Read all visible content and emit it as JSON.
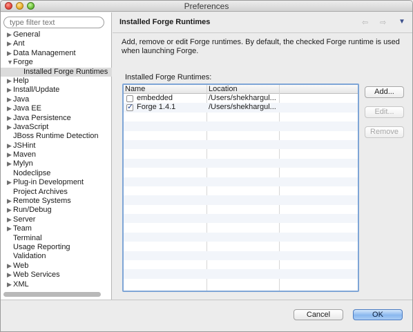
{
  "window": {
    "title": "Preferences"
  },
  "filter": {
    "placeholder": "type filter text"
  },
  "tree": [
    {
      "label": "General",
      "arrow": true,
      "expanded": false,
      "child": false
    },
    {
      "label": "Ant",
      "arrow": true,
      "expanded": false,
      "child": false
    },
    {
      "label": "Data Management",
      "arrow": true,
      "expanded": false,
      "child": false
    },
    {
      "label": "Forge",
      "arrow": true,
      "expanded": true,
      "child": false
    },
    {
      "label": "Installed Forge Runtimes",
      "arrow": false,
      "child": true,
      "selected": true
    },
    {
      "label": "Help",
      "arrow": true,
      "expanded": false,
      "child": false
    },
    {
      "label": "Install/Update",
      "arrow": true,
      "expanded": false,
      "child": false
    },
    {
      "label": "Java",
      "arrow": true,
      "expanded": false,
      "child": false
    },
    {
      "label": "Java EE",
      "arrow": true,
      "expanded": false,
      "child": false
    },
    {
      "label": "Java Persistence",
      "arrow": true,
      "expanded": false,
      "child": false
    },
    {
      "label": "JavaScript",
      "arrow": true,
      "expanded": false,
      "child": false
    },
    {
      "label": "JBoss Runtime Detection",
      "arrow": false,
      "child": false
    },
    {
      "label": "JSHint",
      "arrow": true,
      "expanded": false,
      "child": false
    },
    {
      "label": "Maven",
      "arrow": true,
      "expanded": false,
      "child": false
    },
    {
      "label": "Mylyn",
      "arrow": true,
      "expanded": false,
      "child": false
    },
    {
      "label": "Nodeclipse",
      "arrow": false,
      "child": false
    },
    {
      "label": "Plug-in Development",
      "arrow": true,
      "expanded": false,
      "child": false
    },
    {
      "label": "Project Archives",
      "arrow": false,
      "child": false
    },
    {
      "label": "Remote Systems",
      "arrow": true,
      "expanded": false,
      "child": false
    },
    {
      "label": "Run/Debug",
      "arrow": true,
      "expanded": false,
      "child": false
    },
    {
      "label": "Server",
      "arrow": true,
      "expanded": false,
      "child": false
    },
    {
      "label": "Team",
      "arrow": true,
      "expanded": false,
      "child": false
    },
    {
      "label": "Terminal",
      "arrow": false,
      "child": false
    },
    {
      "label": "Usage Reporting",
      "arrow": false,
      "child": false
    },
    {
      "label": "Validation",
      "arrow": false,
      "child": false
    },
    {
      "label": "Web",
      "arrow": true,
      "expanded": false,
      "child": false
    },
    {
      "label": "Web Services",
      "arrow": true,
      "expanded": false,
      "child": false
    },
    {
      "label": "XML",
      "arrow": true,
      "expanded": false,
      "child": false
    }
  ],
  "page": {
    "title": "Installed Forge Runtimes",
    "description": "Add, remove or edit Forge runtimes. By default, the checked Forge runtime is used when launching Forge.",
    "table_label": "Installed Forge Runtimes:",
    "columns": [
      "Name",
      "Location"
    ],
    "rows": [
      {
        "name": "embedded",
        "location": "/Users/shekhargul...",
        "checked": false
      },
      {
        "name": "Forge 1.4.1",
        "location": "/Users/shekhargul...",
        "checked": true
      }
    ],
    "buttons": {
      "add": "Add...",
      "edit": "Edit...",
      "remove": "Remove"
    },
    "nav": {
      "back": "⇦",
      "forward": "⇨",
      "menu": "▼"
    }
  },
  "footer": {
    "cancel": "Cancel",
    "ok": "OK"
  },
  "icons": {
    "collapsed": "collapsed-arrow-icon",
    "expanded": "expanded-arrow-icon"
  },
  "colors": {
    "accent": "#7ea5d6",
    "ok_button": "#8ab8ef"
  }
}
